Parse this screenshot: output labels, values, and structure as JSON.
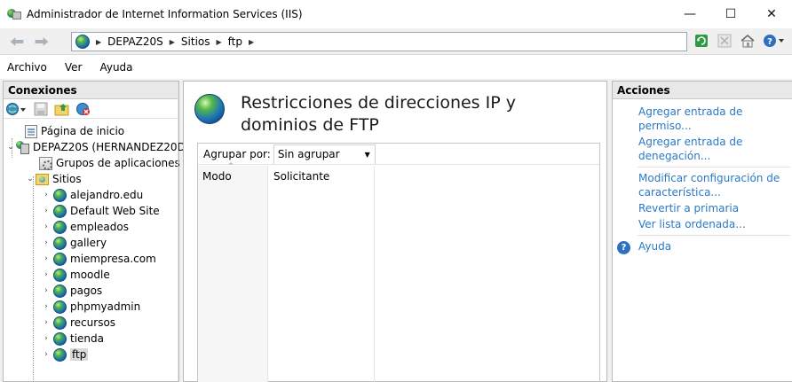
{
  "window": {
    "title": "Administrador de Internet Information Services (IIS)",
    "minimize_glyph": "—",
    "maximize_glyph": "☐",
    "close_glyph": "✕"
  },
  "address": {
    "back_icon": "back-arrow-icon",
    "forward_icon": "forward-arrow-icon",
    "crumbs": [
      "DEPAZ20S",
      "Sitios",
      "ftp"
    ],
    "icons": [
      "refresh-icon",
      "stop-icon",
      "home-icon",
      "help-icon"
    ]
  },
  "menu": {
    "items": [
      "Archivo",
      "Ver",
      "Ayuda"
    ]
  },
  "connections": {
    "header": "Conexiones",
    "tree": {
      "start_page": "Página de inicio",
      "server": "DEPAZ20S (HERNANDEZ20DC",
      "app_pools": "Grupos de aplicaciones",
      "sites": "Sitios",
      "site_list": [
        "alejandro.edu",
        "Default Web Site",
        "empleados",
        "gallery",
        "miempresa.com",
        "moodle",
        "pagos",
        "phpmyadmin",
        "recursos",
        "tienda",
        "ftp"
      ],
      "selected_site": "ftp"
    }
  },
  "feature": {
    "title": "Restricciones de direcciones IP y dominios de FTP",
    "group_by_label": "Agrupar por:",
    "group_by_value": "Sin agrupar",
    "columns": [
      "Modo",
      "Solicitante"
    ]
  },
  "actions": {
    "header": "Acciones",
    "items": [
      "Agregar entrada de permiso...",
      "Agregar entrada de denegación...",
      "Modificar configuración de característica...",
      "Revertir a primaria",
      "Ver lista ordenada..."
    ],
    "help": "Ayuda",
    "link_color": "#2b78c5"
  }
}
